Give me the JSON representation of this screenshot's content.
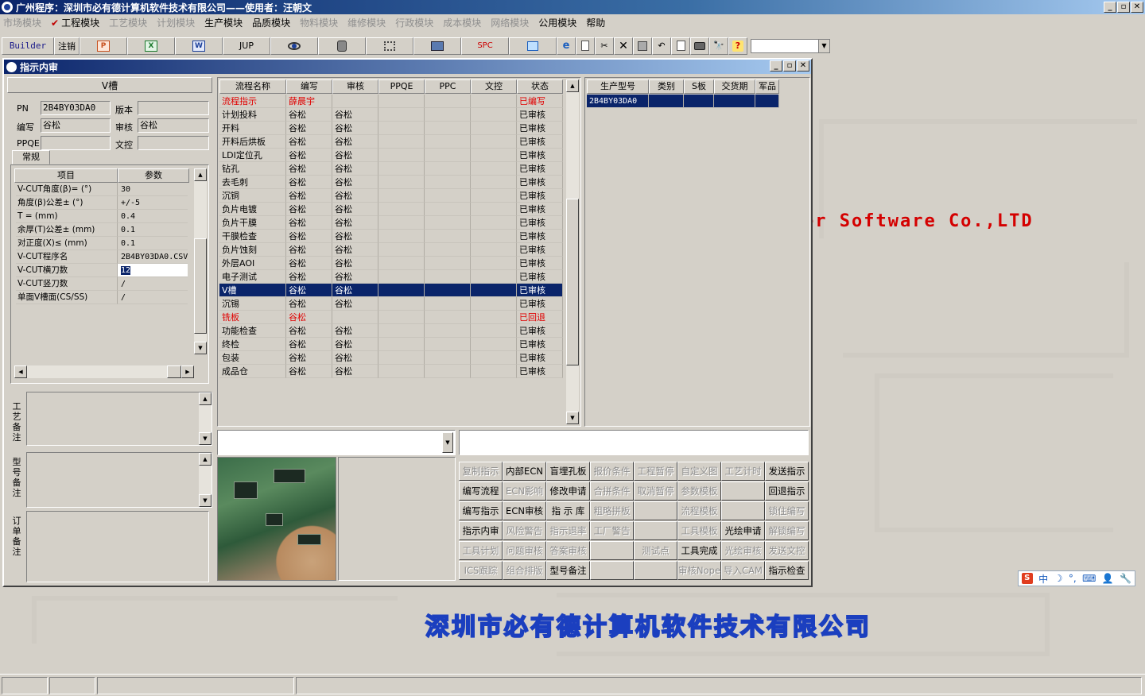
{
  "app": {
    "title": "广州程序：深圳市必有德计算机软件技术有限公司——使用者：汪朝文",
    "window_buttons": [
      "_",
      "▫",
      "✕"
    ]
  },
  "menu": [
    {
      "label": "市场模块",
      "enabled": false
    },
    {
      "label": "工程模块",
      "enabled": true,
      "checked": true
    },
    {
      "label": "工艺模块",
      "enabled": false
    },
    {
      "label": "计划模块",
      "enabled": false
    },
    {
      "label": "生产模块",
      "enabled": true
    },
    {
      "label": "品质模块",
      "enabled": true
    },
    {
      "label": "物料模块",
      "enabled": false
    },
    {
      "label": "维修模块",
      "enabled": false
    },
    {
      "label": "行政模块",
      "enabled": false
    },
    {
      "label": "成本模块",
      "enabled": false
    },
    {
      "label": "网络模块",
      "enabled": false
    },
    {
      "label": "公用模块",
      "enabled": true
    },
    {
      "label": "帮助",
      "enabled": true
    }
  ],
  "toolbar": {
    "builder": "Builder",
    "logout": "注销",
    "ppt_icon": "P",
    "xls_icon": "X",
    "doc_icon": "W",
    "jup": "JUP",
    "spc": "SPC",
    "help_icon": "?",
    "binoculars_icon": "🔭",
    "icons": [
      "eye-icon",
      "database-icon",
      "network-icon",
      "computer-icon",
      "chart-icon",
      "ie-icon",
      "new-file-icon",
      "cut-icon",
      "delete-icon",
      "save-icon",
      "undo-icon",
      "preview-icon",
      "print-icon"
    ]
  },
  "background": {
    "english_text": "er Software Co.,LTD",
    "chinese_text": "深圳市必有德计算机软件技术有限公司"
  },
  "ime": {
    "logo": "S",
    "mode": "中",
    "moon": "☽",
    "punct": "°,",
    "keyboard": "⌨",
    "user": "👤",
    "tool": "🔧"
  },
  "child": {
    "title": "指示内审",
    "buttons": [
      "_",
      "▫",
      "✕"
    ]
  },
  "left": {
    "section_title": "V槽",
    "fields": {
      "pn_label": "PN",
      "pn_value": "2B4BY03DA0",
      "version_label": "版本",
      "version_value": "",
      "author_label": "编写",
      "author_value": "谷松",
      "review_label": "审核",
      "review_value": "谷松",
      "ppqe_label": "PPQE",
      "ppqe_value": "",
      "control_label": "文控",
      "control_value": ""
    },
    "tab": "常规",
    "param_headers": [
      "项目",
      "参数"
    ],
    "params": [
      {
        "name": "V-CUT角度(β)=  (°)",
        "value": "30"
      },
      {
        "name": "角度(β)公差±  (°)",
        "value": "+/-5"
      },
      {
        "name": "T =  (mm)",
        "value": "0.4"
      },
      {
        "name": "余厚(T)公差±  (mm)",
        "value": "0.1"
      },
      {
        "name": "对正度(X)≤  (mm)",
        "value": "0.1"
      },
      {
        "name": "V-CUT程序名",
        "value": "2B4BY03DA0.CSV"
      },
      {
        "name": "V-CUT横刀数",
        "value": "12",
        "editing": true
      },
      {
        "name": "V-CUT竖刀数",
        "value": "/"
      },
      {
        "name": "单面V槽面(CS/SS)",
        "value": "/"
      }
    ],
    "notes": [
      {
        "label": "工艺备注"
      },
      {
        "label": "型号备注"
      },
      {
        "label": "订单备注"
      }
    ]
  },
  "process": {
    "headers": [
      "流程名称",
      "编写",
      "审核",
      "PPQE",
      "PPC",
      "文控",
      "状态"
    ],
    "rows": [
      {
        "name": "流程指示",
        "author": "薛晨宇",
        "review": "",
        "status": "已编写",
        "style": "red"
      },
      {
        "name": "计划投料",
        "author": "谷松",
        "review": "谷松",
        "status": "已审核"
      },
      {
        "name": "开料",
        "author": "谷松",
        "review": "谷松",
        "status": "已审核"
      },
      {
        "name": "开料后烘板",
        "author": "谷松",
        "review": "谷松",
        "status": "已审核"
      },
      {
        "name": "LDI定位孔",
        "author": "谷松",
        "review": "谷松",
        "status": "已审核"
      },
      {
        "name": "钻孔",
        "author": "谷松",
        "review": "谷松",
        "status": "已审核"
      },
      {
        "name": "去毛刺",
        "author": "谷松",
        "review": "谷松",
        "status": "已审核"
      },
      {
        "name": "沉铜",
        "author": "谷松",
        "review": "谷松",
        "status": "已审核"
      },
      {
        "name": "负片电镀",
        "author": "谷松",
        "review": "谷松",
        "status": "已审核"
      },
      {
        "name": "负片干膜",
        "author": "谷松",
        "review": "谷松",
        "status": "已审核"
      },
      {
        "name": "干膜检查",
        "author": "谷松",
        "review": "谷松",
        "status": "已审核"
      },
      {
        "name": "负片蚀刻",
        "author": "谷松",
        "review": "谷松",
        "status": "已审核"
      },
      {
        "name": "外层AOI",
        "author": "谷松",
        "review": "谷松",
        "status": "已审核"
      },
      {
        "name": "电子测试",
        "author": "谷松",
        "review": "谷松",
        "status": "已审核"
      },
      {
        "name": "V槽",
        "author": "谷松",
        "review": "谷松",
        "status": "已审核",
        "style": "sel"
      },
      {
        "name": "沉锡",
        "author": "谷松",
        "review": "谷松",
        "status": "已审核"
      },
      {
        "name": "铣板",
        "author": "谷松",
        "review": "",
        "status": "已回退",
        "style": "red"
      },
      {
        "name": "功能检查",
        "author": "谷松",
        "review": "谷松",
        "status": "已审核"
      },
      {
        "name": "终检",
        "author": "谷松",
        "review": "谷松",
        "status": "已审核"
      },
      {
        "name": "包装",
        "author": "谷松",
        "review": "谷松",
        "status": "已审核"
      },
      {
        "name": "成品仓",
        "author": "谷松",
        "review": "谷松",
        "status": "已审核"
      }
    ]
  },
  "product": {
    "headers": [
      "生产型号",
      "类别",
      "S板",
      "交货期",
      "军品"
    ],
    "rows": [
      {
        "model": "2B4BY03DA0",
        "category": "",
        "s_board": "",
        "delivery": "",
        "military": ""
      }
    ]
  },
  "action_buttons": [
    [
      {
        "label": "复制指示",
        "enabled": false
      },
      {
        "label": "内部ECN",
        "enabled": true
      },
      {
        "label": "盲埋孔板",
        "enabled": true
      },
      {
        "label": "报价条件",
        "enabled": false
      },
      {
        "label": "工程暂停",
        "enabled": false
      },
      {
        "label": "自定义图",
        "enabled": false
      },
      {
        "label": "工艺计时",
        "enabled": false
      },
      {
        "label": "发送指示",
        "enabled": true
      }
    ],
    [
      {
        "label": "编写流程",
        "enabled": true
      },
      {
        "label": "ECN影响",
        "enabled": false
      },
      {
        "label": "修改申请",
        "enabled": true
      },
      {
        "label": "合拼条件",
        "enabled": false
      },
      {
        "label": "取消暂停",
        "enabled": false
      },
      {
        "label": "参数模板",
        "enabled": false
      },
      {
        "label": "",
        "enabled": false
      },
      {
        "label": "回退指示",
        "enabled": true
      }
    ],
    [
      {
        "label": "编写指示",
        "enabled": true
      },
      {
        "label": "ECN审核",
        "enabled": true
      },
      {
        "label": "指 示 库",
        "enabled": true
      },
      {
        "label": "粗略拼板",
        "enabled": false
      },
      {
        "label": "",
        "enabled": false
      },
      {
        "label": "流程模板",
        "enabled": false
      },
      {
        "label": "",
        "enabled": false
      },
      {
        "label": "锁住编写",
        "enabled": false
      }
    ],
    [
      {
        "label": "指示内审",
        "enabled": true
      },
      {
        "label": "风险警告",
        "enabled": false
      },
      {
        "label": "指示退率",
        "enabled": false
      },
      {
        "label": "工厂警告",
        "enabled": false
      },
      {
        "label": "",
        "enabled": false
      },
      {
        "label": "工具模板",
        "enabled": false
      },
      {
        "label": "光绘申请",
        "enabled": true
      },
      {
        "label": "解锁编写",
        "enabled": false
      }
    ],
    [
      {
        "label": "工具计划",
        "enabled": false
      },
      {
        "label": "问题审核",
        "enabled": false
      },
      {
        "label": "答案审核",
        "enabled": false
      },
      {
        "label": "",
        "enabled": false
      },
      {
        "label": "测试点",
        "enabled": false
      },
      {
        "label": "工具完成",
        "enabled": true
      },
      {
        "label": "光绘审核",
        "enabled": false
      },
      {
        "label": "发送文控",
        "enabled": false
      }
    ],
    [
      {
        "label": "ICS跟踪",
        "enabled": false
      },
      {
        "label": "组合排版",
        "enabled": false
      },
      {
        "label": "型号备注",
        "enabled": true
      },
      {
        "label": "",
        "enabled": false
      },
      {
        "label": "",
        "enabled": false
      },
      {
        "label": "审核Nope",
        "enabled": false
      },
      {
        "label": "导入CAM",
        "enabled": false
      },
      {
        "label": "指示检查",
        "enabled": true
      }
    ]
  ]
}
